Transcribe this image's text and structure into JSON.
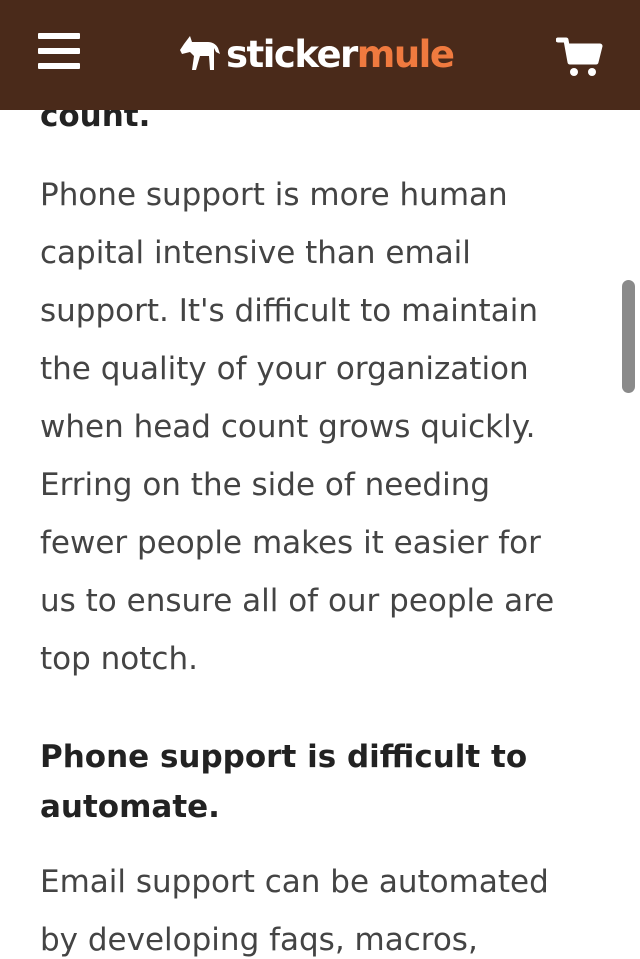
{
  "header": {
    "logo_primary": "sticker",
    "logo_accent": "mule",
    "menu_icon": "hamburger-menu-icon",
    "cart_icon": "shopping-cart-icon",
    "logo_icon": "mule-icon",
    "colors": {
      "background": "#4a2a1a",
      "logo_primary": "#ffffff",
      "logo_accent": "#f07a3f"
    }
  },
  "article": {
    "heading_fragment": "count.",
    "paragraph_1_lines": [
      "Phone support is more human",
      "capital intensive than email",
      "support. It's difficult to maintain",
      "the quality of your organization",
      "when head count grows quickly.",
      "Erring on the side of needing",
      "fewer people makes it easier for",
      "us to ensure all of our people are",
      "top notch."
    ],
    "heading_2_lines": [
      "Phone support is difficult to",
      "automate."
    ],
    "paragraph_2_lines": [
      "Email support can be automated",
      "by developing faqs, macros,"
    ]
  }
}
